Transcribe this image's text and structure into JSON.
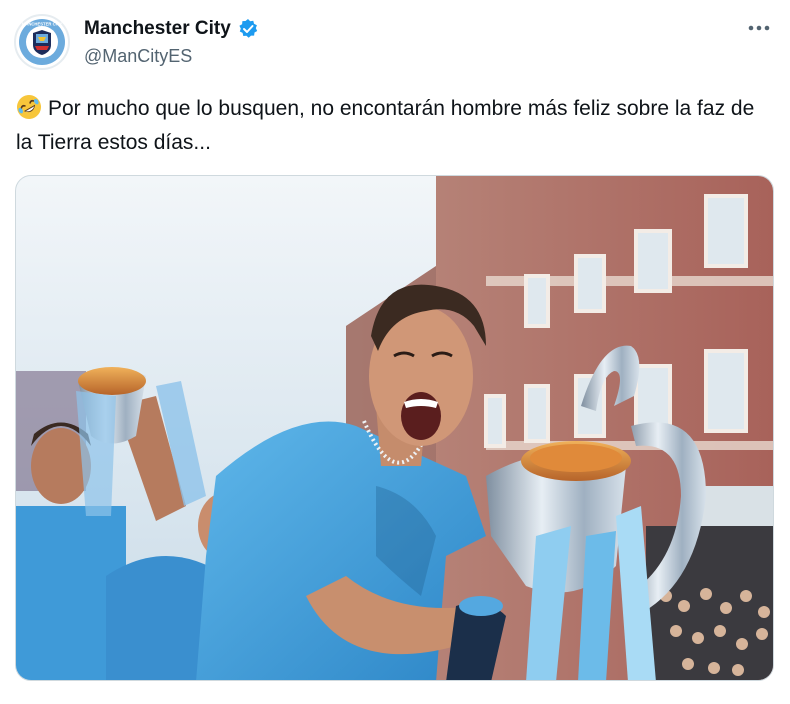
{
  "author": {
    "display_name": "Manchester City",
    "handle": "@ManCityES",
    "verified": true,
    "avatar_icon": "manchester-city-crest-icon",
    "avatar_text": "MANCHESTER CITY"
  },
  "tweet": {
    "emoji": "rolling-on-floor-laughing-emoji",
    "text": "Por mucho que lo busquen, no encontarán hombre más feliz sobre la faz de la Tierra estos días..."
  },
  "more_icon": "more-options-icon",
  "media": {
    "description_icon": "celebration-photo-image"
  },
  "colors": {
    "verified_blue": "#1d9bf0",
    "text": "#0f1419",
    "secondary_text": "#536471",
    "city_blue": "#6cabdd"
  }
}
